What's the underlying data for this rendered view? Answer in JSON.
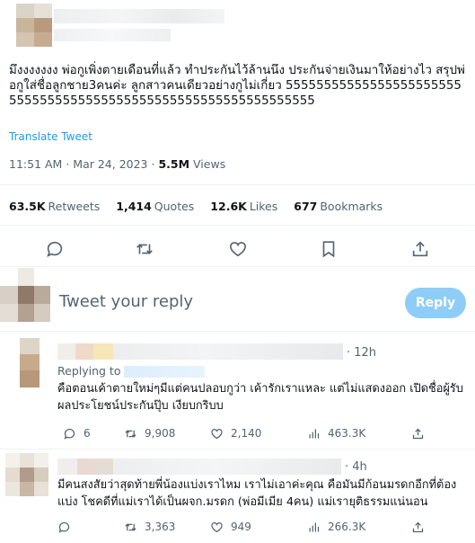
{
  "tweet": {
    "text": "มึงงงงงงง พ่อกูเพิ่งตายเดือนที่แล้ว ทำประกันไว้ล้านนึง ประกันจ่ายเงินมาให้อย่างไว สรุปพ่อกูใส่ชื่อลูกชาย3คนค่ะ ลูกสาวคนเดียวอย่างกูไม่เกี่ยว 555555555555555555555555555555555555555555555555555555555555555",
    "translate_label": "Translate Tweet",
    "time": "11:51 AM",
    "date": "Mar 24, 2023",
    "views_count": "5.5M",
    "views_label": "Views"
  },
  "stats": {
    "retweets_count": "63.5K",
    "retweets_label": "Retweets",
    "quotes_count": "1,414",
    "quotes_label": "Quotes",
    "likes_count": "12.6K",
    "likes_label": "Likes",
    "bookmarks_count": "677",
    "bookmarks_label": "Bookmarks"
  },
  "composer": {
    "placeholder": "Tweet your reply",
    "reply_button": "Reply"
  },
  "replies": [
    {
      "time": "12h",
      "replying_label": "Replying to",
      "text": "คือตอนเค้าตายใหม่ๆมีแต่คนปลอบกูว่า เค้ารักเราแหละ แต่ไม่แสดงออก เปิดชื่อผู้รับผลประโยชน์ประกันปุ๊บ เงียบกริบบ",
      "replies_count": "6",
      "retweets_count": "9,908",
      "likes_count": "2,140",
      "views_count": "463.3K"
    },
    {
      "time": "4h",
      "text": "มีคนสงสัยว่าสุดท้ายพี่น้องแบ่งเราไหม เราไม่เอาค่ะคุณ คือมันมีก้อนมรดกอีกที่ต้องแบ่ง โชคดีที่แม่เราได้เป็นผจก.มรดก (พ่อมีเมีย 4คน) แม่เรายุติธรรมแน่นอน",
      "retweets_count": "3,363",
      "likes_count": "949",
      "views_count": "266.3K"
    }
  ],
  "icons": {
    "reply": "speech-bubble-icon",
    "retweet": "retweet-arrows-icon",
    "like": "heart-icon",
    "bookmark": "bookmark-icon",
    "share": "share-upload-icon",
    "views": "bar-chart-icon"
  },
  "colors": {
    "link": "#1d9bf0",
    "reply_button": "#8ecdf8",
    "muted_text": "#536471"
  }
}
